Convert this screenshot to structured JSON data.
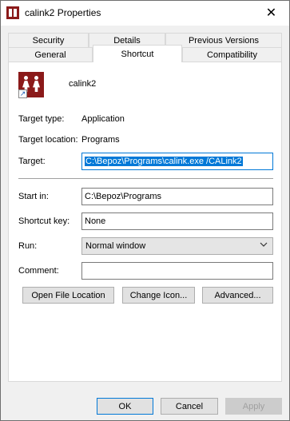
{
  "window": {
    "title": "calink2 Properties",
    "close_glyph": "✕"
  },
  "tabs": {
    "row1": [
      "Security",
      "Details",
      "Previous Versions"
    ],
    "row2": [
      "General",
      "Shortcut",
      "Compatibility"
    ],
    "active": "Shortcut"
  },
  "shortcut": {
    "name": "calink2",
    "target_type_label": "Target type:",
    "target_type_value": "Application",
    "target_location_label": "Target location:",
    "target_location_value": "Programs",
    "target_label": "Target:",
    "target_value": "C:\\Bepoz\\Programs\\calink.exe /CALink2",
    "start_in_label": "Start in:",
    "start_in_value": "C:\\Bepoz\\Programs",
    "shortcut_key_label": "Shortcut key:",
    "shortcut_key_value": "None",
    "run_label": "Run:",
    "run_value": "Normal window",
    "comment_label": "Comment:",
    "comment_value": ""
  },
  "actions": {
    "open_file_location": "Open File Location",
    "change_icon": "Change Icon...",
    "advanced": "Advanced..."
  },
  "footer": {
    "ok": "OK",
    "cancel": "Cancel",
    "apply": "Apply"
  },
  "icons": {
    "app_icon": "calink-app-icon",
    "shortcut_overlay": "shortcut-arrow-icon",
    "dropdown": "chevron-down-icon"
  },
  "colors": {
    "accent": "#0078d7",
    "app_icon_bg": "#8b1a1a"
  }
}
